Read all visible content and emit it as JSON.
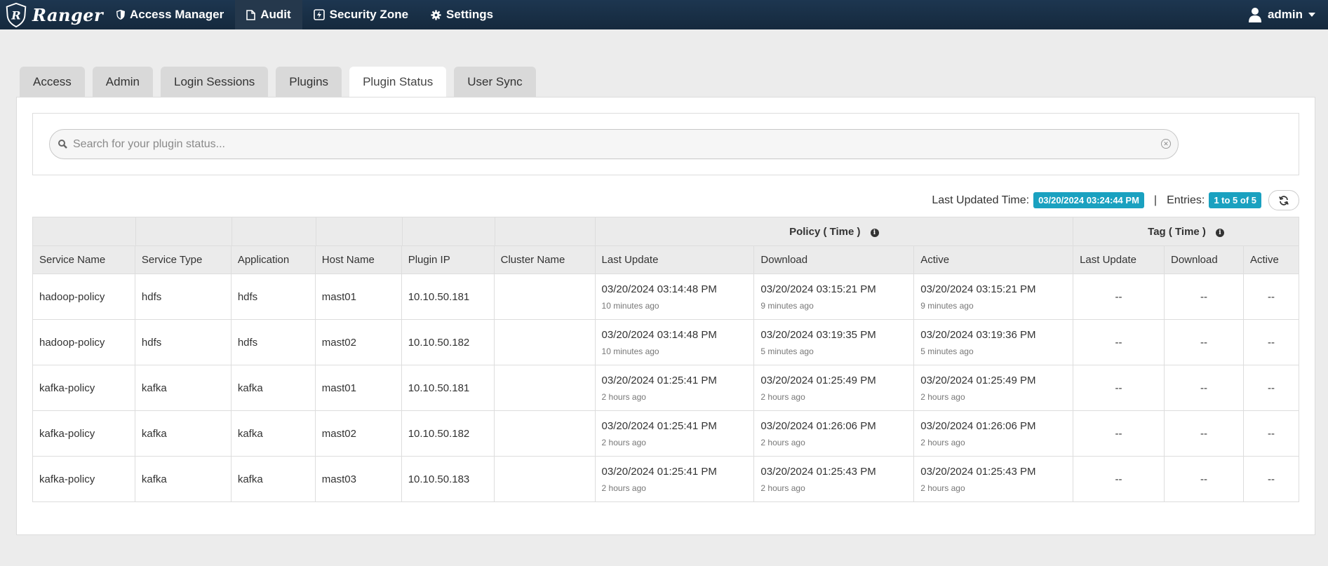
{
  "brand": {
    "name": "Ranger"
  },
  "nav": {
    "items": [
      {
        "label": "Access Manager",
        "icon": "shield-icon"
      },
      {
        "label": "Audit",
        "icon": "file-icon"
      },
      {
        "label": "Security Zone",
        "icon": "bolt-icon"
      },
      {
        "label": "Settings",
        "icon": "gear-icon"
      }
    ],
    "active": "Audit",
    "user": "admin"
  },
  "tabs": [
    {
      "label": "Access"
    },
    {
      "label": "Admin"
    },
    {
      "label": "Login Sessions"
    },
    {
      "label": "Plugins"
    },
    {
      "label": "Plugin Status"
    },
    {
      "label": "User Sync"
    }
  ],
  "active_tab": "Plugin Status",
  "search": {
    "placeholder": "Search for your plugin status...",
    "value": ""
  },
  "info": {
    "last_updated_label": "Last Updated Time:",
    "last_updated_value": "03/20/2024 03:24:44 PM",
    "separator": "|",
    "entries_label": "Entries:",
    "entries_value": "1 to 5 of 5"
  },
  "table": {
    "group_headers": {
      "policy": "Policy ( Time )",
      "tag": "Tag ( Time )"
    },
    "columns": [
      "Service Name",
      "Service Type",
      "Application",
      "Host Name",
      "Plugin IP",
      "Cluster Name",
      "Last Update",
      "Download",
      "Active",
      "Last Update",
      "Download",
      "Active"
    ],
    "rows": [
      {
        "service_name": "hadoop-policy",
        "service_type": "hdfs",
        "application": "hdfs",
        "host_name": "mast01",
        "plugin_ip": "10.10.50.181",
        "cluster_name": "",
        "policy_last_update": "03/20/2024 03:14:48 PM",
        "policy_last_update_ago": "10 minutes ago",
        "policy_download": "03/20/2024 03:15:21 PM",
        "policy_download_ago": "9 minutes ago",
        "policy_active": "03/20/2024 03:15:21 PM",
        "policy_active_ago": "9 minutes ago",
        "tag_last_update": "--",
        "tag_download": "--",
        "tag_active": "--"
      },
      {
        "service_name": "hadoop-policy",
        "service_type": "hdfs",
        "application": "hdfs",
        "host_name": "mast02",
        "plugin_ip": "10.10.50.182",
        "cluster_name": "",
        "policy_last_update": "03/20/2024 03:14:48 PM",
        "policy_last_update_ago": "10 minutes ago",
        "policy_download": "03/20/2024 03:19:35 PM",
        "policy_download_ago": "5 minutes ago",
        "policy_active": "03/20/2024 03:19:36 PM",
        "policy_active_ago": "5 minutes ago",
        "tag_last_update": "--",
        "tag_download": "--",
        "tag_active": "--"
      },
      {
        "service_name": "kafka-policy",
        "service_type": "kafka",
        "application": "kafka",
        "host_name": "mast01",
        "plugin_ip": "10.10.50.181",
        "cluster_name": "",
        "policy_last_update": "03/20/2024 01:25:41 PM",
        "policy_last_update_ago": "2 hours ago",
        "policy_download": "03/20/2024 01:25:49 PM",
        "policy_download_ago": "2 hours ago",
        "policy_active": "03/20/2024 01:25:49 PM",
        "policy_active_ago": "2 hours ago",
        "tag_last_update": "--",
        "tag_download": "--",
        "tag_active": "--"
      },
      {
        "service_name": "kafka-policy",
        "service_type": "kafka",
        "application": "kafka",
        "host_name": "mast02",
        "plugin_ip": "10.10.50.182",
        "cluster_name": "",
        "policy_last_update": "03/20/2024 01:25:41 PM",
        "policy_last_update_ago": "2 hours ago",
        "policy_download": "03/20/2024 01:26:06 PM",
        "policy_download_ago": "2 hours ago",
        "policy_active": "03/20/2024 01:26:06 PM",
        "policy_active_ago": "2 hours ago",
        "tag_last_update": "--",
        "tag_download": "--",
        "tag_active": "--"
      },
      {
        "service_name": "kafka-policy",
        "service_type": "kafka",
        "application": "kafka",
        "host_name": "mast03",
        "plugin_ip": "10.10.50.183",
        "cluster_name": "",
        "policy_last_update": "03/20/2024 01:25:41 PM",
        "policy_last_update_ago": "2 hours ago",
        "policy_download": "03/20/2024 01:25:43 PM",
        "policy_download_ago": "2 hours ago",
        "policy_active": "03/20/2024 01:25:43 PM",
        "policy_active_ago": "2 hours ago",
        "tag_last_update": "--",
        "tag_download": "--",
        "tag_active": "--"
      }
    ]
  },
  "colors": {
    "navbar": "#1d3650",
    "badge": "#1aa1c0",
    "background": "#ececec"
  }
}
